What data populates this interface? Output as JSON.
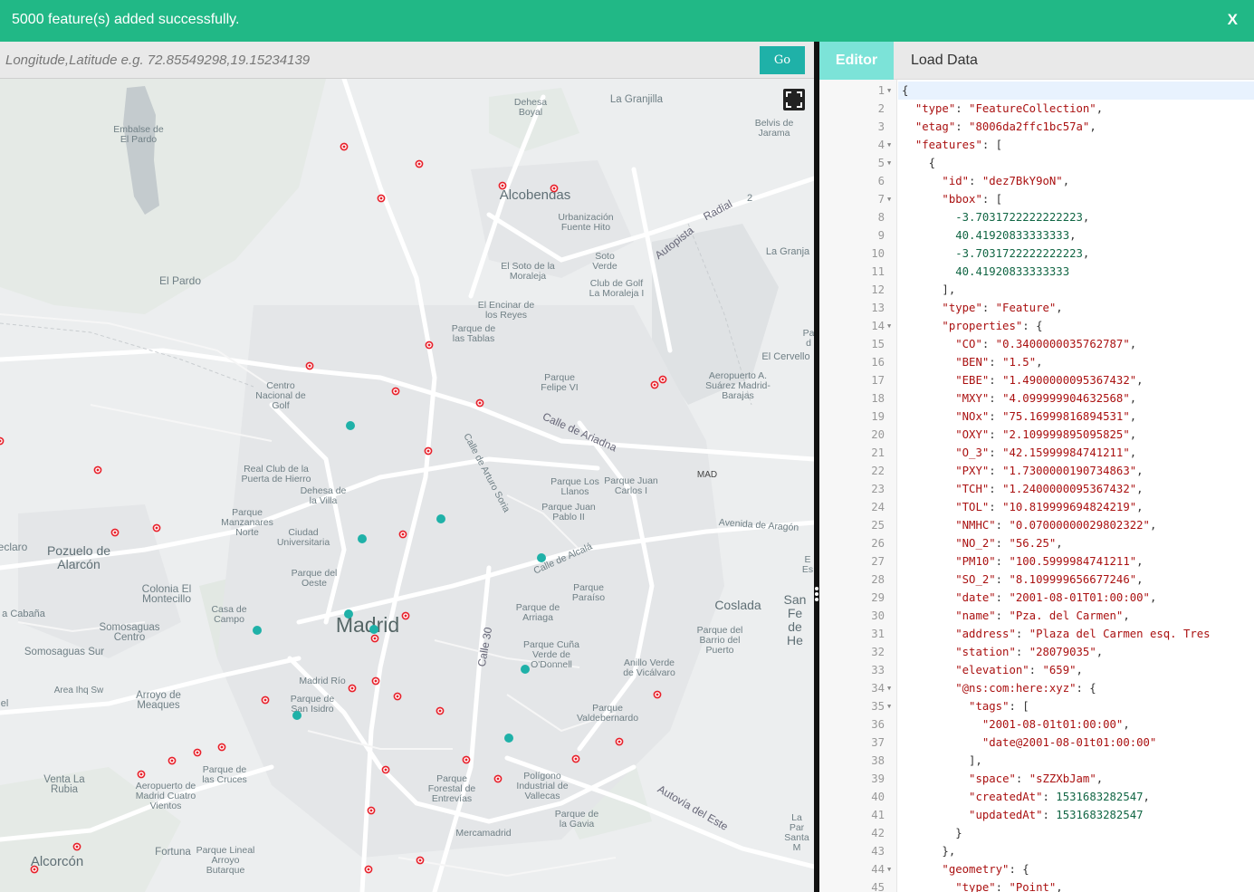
{
  "notification": {
    "message": "5000 feature(s) added successfully.",
    "close_label": "X"
  },
  "search": {
    "placeholder": "Longitude,Latitude e.g. 72.85549298,19.15234139",
    "value": "",
    "go_label": "Go"
  },
  "map": {
    "labels": {
      "embalse": "Embalse de\nEl Pardo",
      "dehesa_boyal": "Dehesa\nBoyal",
      "la_granjilla": "La Granjilla",
      "belvis": "Belvis de\nJarama",
      "alcobendas": "Alcobendas",
      "urbanizacion": "Urbanización\nFuente Hito",
      "radial": "Radial",
      "radial_num": "2",
      "autopista": "Autopista",
      "la_granja": "La Granja",
      "soto_verde": "Soto\nVerde",
      "el_soto": "El Soto de la\nMoraleja",
      "club_golf": "Club de Golf\nLa Moraleja I",
      "el_pardo": "El Pardo",
      "el_encinar": "El Encinar de\nlos Reyes",
      "parque_tablas": "Parque de\nlas Tablas",
      "el_cervello": "El Cervello",
      "pa_edge": "Pa\nd",
      "aeropuerto": "Aeropuerto A.\nSuárez Madrid-\nBarajas",
      "centro_golf": "Centro\nNacional de\nGolf",
      "parque_felipe": "Parque\nFelipe VI",
      "calle_ariadna": "Calle de Ariadna",
      "calle_arturo": "Calle de Arturo Soria",
      "real_club": "Real Club de la\nPuerta de Hierro",
      "dehesa_villa": "Dehesa de\nla Villa",
      "parque_llanos": "Parque Los\nLlanos",
      "parque_carlos": "Parque Juan\nCarlos I",
      "mad": "MAD",
      "parque_pablo": "Parque Juan\nPablo II",
      "parque_manzanares": "Parque\nManzanares\nNorte",
      "ciudad_univ": "Ciudad\nUniversitaria",
      "avenida_aragon": "Avenida de Aragón",
      "eclaro": "eclaro",
      "pozuelo": "Pozuelo de\nAlarcón",
      "calle_alcala": "Calle de Alcalá",
      "e_edge": "E\nEs",
      "parque_oeste": "Parque del\nOeste",
      "parque_paraiso": "Parque\nParaíso",
      "colonia": "Colonia El\nMontecillo",
      "parque_arriaga": "Parque de\nArriaga",
      "coslada": "Coslada",
      "san_fe": "San Fe\nde He",
      "a_cabana": "a Cabaña",
      "casa_campo": "Casa de\nCampo",
      "madrid": "Madrid",
      "somosaguas_centro": "Somosaguas\nCentro",
      "calle30": "Calle 30",
      "parque_cuna": "Parque Cuña\nVerde de\nO'Donnell",
      "parque_barrio": "Parque del\nBarrio del\nPuerto",
      "somosaguas_sur": "Somosaguas Sur",
      "madrid_rio": "Madrid Río",
      "anillo": "Anillo Verde\nde Vicálvaro",
      "area_sw": "Area Ihq Sw",
      "arroyo_meaques": "Arroyo de\nMeaques",
      "parque_isidro": "Parque de\nSan Isidro",
      "el_edge": "el",
      "parque_valdebernardo": "Parque\nValdebernardo",
      "parque_cruces": "Parque de\nlas Cruces",
      "venta_rubia": "Venta La\nRubia",
      "aeropuerto_cuatro": "Aeropuerto de\nMadrid Cuatro\nVientos",
      "parque_entrevias": "Parque\nForestal de\nEntrevías",
      "poligono": "Polígono\nIndustrial de\nVallecas",
      "autovia_este": "Autovía del Este",
      "parque_gavia": "Parque de\nla Gavia",
      "la_par": "La Par\nSanta M",
      "mercamadrid": "Mercamadrid",
      "alcorcon": "Alcorcón",
      "fortuna": "Fortuna",
      "parque_lineal": "Parque Lineal\nArroyo\nButarque"
    }
  },
  "tabs": {
    "editor": "Editor",
    "load_data": "Load Data"
  },
  "editor": {
    "lines": [
      "{",
      "  \"type\": \"FeatureCollection\",",
      "  \"etag\": \"8006da2ffc1bc57a\",",
      "  \"features\": [",
      "    {",
      "      \"id\": \"dez7BkY9oN\",",
      "      \"bbox\": [",
      "        -3.7031722222222223,",
      "        40.41920833333333,",
      "        -3.7031722222222223,",
      "        40.41920833333333",
      "      ],",
      "      \"type\": \"Feature\",",
      "      \"properties\": {",
      "        \"CO\": \"0.3400000035762787\",",
      "        \"BEN\": \"1.5\",",
      "        \"EBE\": \"1.4900000095367432\",",
      "        \"MXY\": \"4.099999904632568\",",
      "        \"NOx\": \"75.16999816894531\",",
      "        \"OXY\": \"2.109999895095825\",",
      "        \"O_3\": \"42.15999984741211\",",
      "        \"PXY\": \"1.7300000190734863\",",
      "        \"TCH\": \"1.2400000095367432\",",
      "        \"TOL\": \"10.819999694824219\",",
      "        \"NMHC\": \"0.07000000029802322\",",
      "        \"NO_2\": \"56.25\",",
      "        \"PM10\": \"100.5999984741211\",",
      "        \"SO_2\": \"8.109999656677246\",",
      "        \"date\": \"2001-08-01T01:00:00\",",
      "        \"name\": \"Pza. del Carmen\",",
      "        \"address\": \"Plaza del Carmen esq. Tres",
      "        \"station\": \"28079035\",",
      "        \"elevation\": \"659\",",
      "        \"@ns:com:here:xyz\": {",
      "          \"tags\": [",
      "            \"2001-08-01t01:00:00\",",
      "            \"date@2001-08-01t01:00:00\"",
      "          ],",
      "          \"space\": \"sZZXbJam\",",
      "          \"createdAt\": 1531683282547,",
      "          \"updatedAt\": 1531683282547",
      "        }",
      "      },",
      "      \"geometry\": {",
      "        \"type\": \"Point\","
    ],
    "fold_lines": [
      1,
      4,
      5,
      7,
      14,
      34,
      35,
      44
    ]
  },
  "colors": {
    "banner": "#21b886",
    "go_button": "#1fb1a8",
    "editor_tab": "#7ce3d8",
    "red_marker": "#e8202a",
    "teal_marker": "#1fb1a8"
  }
}
